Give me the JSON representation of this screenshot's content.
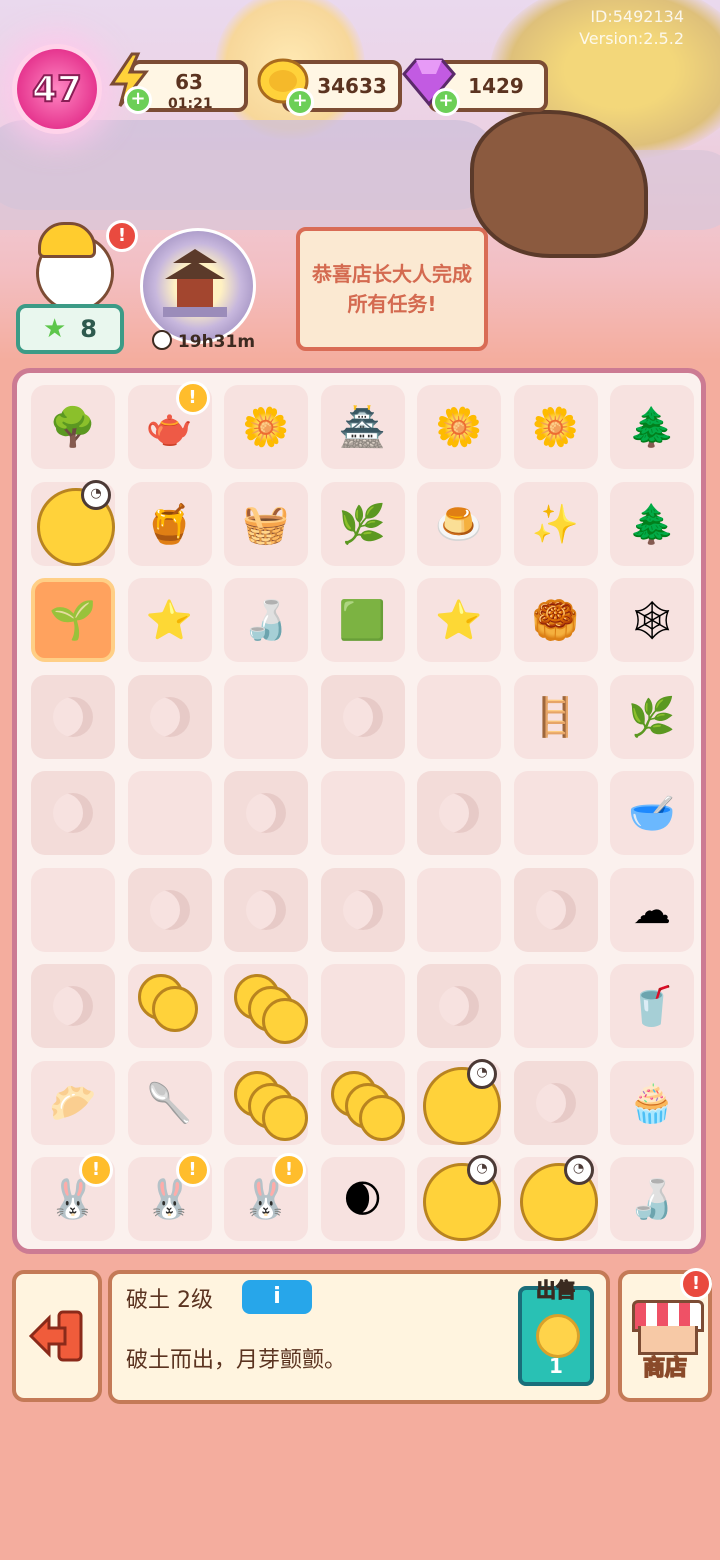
{
  "header": {
    "id_text": "ID:5492134",
    "version_text": "Version:2.5.2",
    "level": "47",
    "energy": {
      "value": "63",
      "timer": "01:21"
    },
    "coins": {
      "value": "34633"
    },
    "gems": {
      "value": "1429"
    },
    "plus_symbol": "+"
  },
  "helper": {
    "star_count": "8",
    "alert_symbol": "!"
  },
  "event": {
    "timer": "19h31m"
  },
  "quest": {
    "text": "恭喜店长大人完成所有任务!"
  },
  "board": {
    "rows": [
      [
        "tree-gold",
        "teapot",
        "osmanthus-branch",
        "pavilion",
        "osmanthus-cluster",
        "osmanthus-flower",
        "tree-blue"
      ],
      [
        "coin-locked",
        "jam-jar",
        "flower-basket",
        "petal",
        "jelly",
        "petals-pair",
        "tree-blue-small"
      ],
      [
        "sprout",
        "star-small",
        "wine-bottle",
        "tray",
        "star-plate",
        "mooncake",
        "spider-web"
      ],
      [
        "moon",
        "moon",
        "empty",
        "moon",
        "empty",
        "rack",
        "sapling-blue"
      ],
      [
        "moon",
        "empty",
        "moon",
        "empty",
        "moon",
        "empty",
        "soup-bowl"
      ],
      [
        "empty",
        "moon",
        "moon",
        "moon",
        "empty",
        "moon",
        "cloud"
      ],
      [
        "moon",
        "coins-two",
        "coins-stack",
        "empty",
        "moon",
        "empty",
        "drink-cup"
      ],
      [
        "bunny-buns",
        "wooden-scoop",
        "coins-pile",
        "coins-heap",
        "coin-locked",
        "moon",
        "cupcake"
      ],
      [
        "bunny-mortar",
        "bunny-pot",
        "bunny-bowl",
        "moon-dark",
        "coin-locked",
        "coin-locked",
        "wine-set"
      ]
    ],
    "badges": {
      "teapot": "!",
      "bunny-mortar": "!",
      "bunny-pot": "!",
      "bunny-bowl": "!"
    },
    "selected": "sprout"
  },
  "info": {
    "item_name": "破土 2级",
    "info_icon": "i",
    "item_desc": "破土而出，月芽颤颤。",
    "sell_label": "出售",
    "sell_price": "1"
  },
  "shop": {
    "label": "商店",
    "alert_symbol": "!"
  },
  "colors": {
    "accent": "#cc7b93",
    "panel_border": "#c47a57",
    "sell": "#29c1b4"
  }
}
